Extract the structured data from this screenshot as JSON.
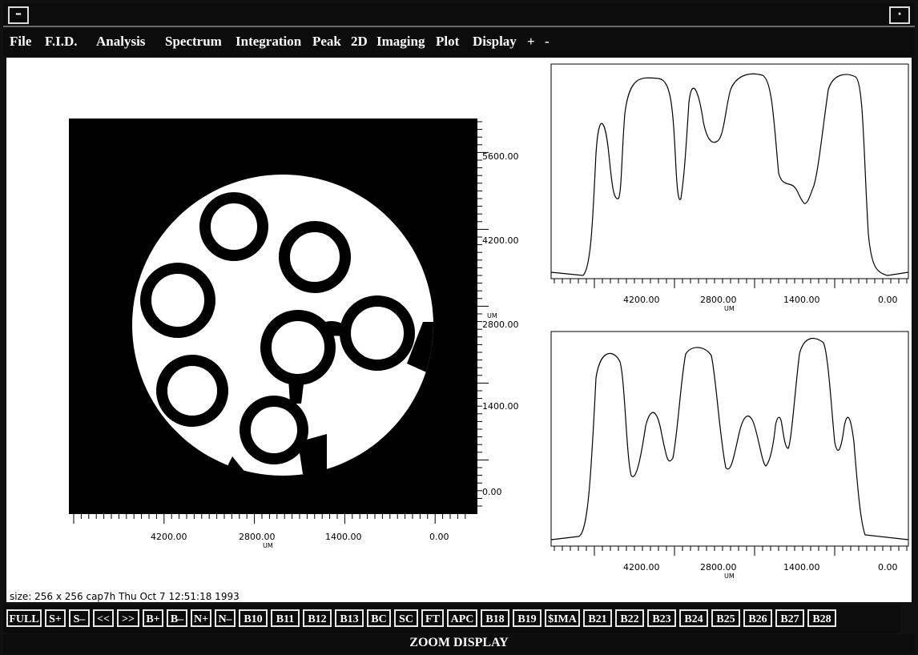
{
  "window": {
    "menu_button": "–",
    "maximize_button": "·"
  },
  "menu": [
    {
      "label": "File"
    },
    {
      "label": "F.I.D."
    },
    {
      "label": "Analysis"
    },
    {
      "label": "Spectrum"
    },
    {
      "label": "Integration"
    },
    {
      "label": "Peak"
    },
    {
      "label": "2D"
    },
    {
      "label": "Imaging"
    },
    {
      "label": "Plot"
    },
    {
      "label": "Display"
    },
    {
      "label": "+"
    },
    {
      "label": "-"
    }
  ],
  "image_panel": {
    "y_ticks": [
      "5600.00",
      "4200.00",
      "2800.00",
      "1400.00",
      "0.00"
    ],
    "y_unit": "UM",
    "x_ticks": [
      "4200.00",
      "2800.00",
      "1400.00",
      "0.00"
    ],
    "x_unit": "UM"
  },
  "profile_top": {
    "x_ticks": [
      "4200.00",
      "2800.00",
      "1400.00",
      "0.00"
    ],
    "x_unit": "UM"
  },
  "profile_bottom": {
    "x_ticks": [
      "4200.00",
      "2800.00",
      "1400.00",
      "0.00"
    ],
    "x_unit": "UM"
  },
  "status": "size: 256 x 256 cap7h   Thu Oct  7 12:51:18 1993",
  "buttons": [
    "FULL",
    "S+",
    "S–",
    "<<",
    ">>",
    "B+",
    "B–",
    "N+",
    "N–",
    "B10",
    "B11",
    "B12",
    "B13",
    "BC",
    "SC",
    "FT",
    "APC",
    "B18",
    "B19",
    "$IMA",
    "B21",
    "B22",
    "B23",
    "B24",
    "B25",
    "B26",
    "B27",
    "B28"
  ],
  "footer": "ZOOM DISPLAY",
  "colors": {
    "chrome": "#0c0c0c",
    "canvas": "#ffffff",
    "trace": "#000000"
  }
}
